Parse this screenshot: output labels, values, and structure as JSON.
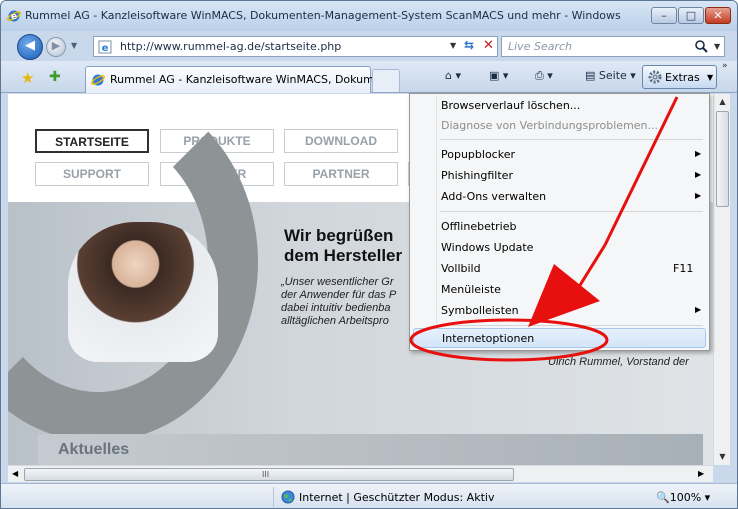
{
  "window": {
    "title": "Rummel AG - Kanzleisoftware WinMACS, Dokumenten-Management-System ScanMACS und mehr - Windows Intern...",
    "buttons": {
      "minimize": "–",
      "maximize": "□",
      "close": "✕"
    }
  },
  "address_bar": {
    "url": "http://www.rummel-ag.de/startseite.php",
    "search_placeholder": "Live Search"
  },
  "tabs": [
    {
      "label": "Rummel AG - Kanzleisoftware WinMACS, Dokum..."
    }
  ],
  "command_bar": {
    "page_label": "Seite",
    "extras_label": "Extras"
  },
  "site": {
    "nav": [
      "STARTSEITE",
      "PRODUKTE",
      "DOWNLOAD",
      "SUPPORT",
      "HÄNDLER",
      "PARTNER"
    ],
    "hero_title_line1": "Wir begrüßen",
    "hero_title_line2": "dem Hersteller",
    "quote_lines": [
      "„Unser wesentlicher Gr",
      "der Anwender für das P",
      "dabei intuitiv bedienba",
      "alltäglichen Arbeitspro"
    ],
    "signature": "Ulrich Rummel, Vorstand der",
    "section_heading": "Aktuelles"
  },
  "menu": {
    "items": [
      {
        "label": "Browserverlauf löschen..."
      },
      {
        "label": "Diagnose von Verbindungsproblemen..."
      },
      {
        "label": "Popupblocker",
        "submenu": true
      },
      {
        "label": "Phishingfilter",
        "submenu": true
      },
      {
        "label": "Add-Ons verwalten",
        "submenu": true
      },
      {
        "label": "Offlinebetrieb"
      },
      {
        "label": "Windows Update"
      },
      {
        "label": "Vollbild",
        "shortcut": "F11"
      },
      {
        "label": "Menüleiste"
      },
      {
        "label": "Symbolleisten",
        "submenu": true
      },
      {
        "label": "Internetoptionen"
      }
    ]
  },
  "status_bar": {
    "zone": "Internet | Geschützter Modus: Aktiv",
    "zoom": "100%"
  },
  "scrollbar": {
    "grip": "III"
  },
  "colors": {
    "annotation_red": "#e8100e",
    "menu_highlight": "#d3e5f9"
  }
}
